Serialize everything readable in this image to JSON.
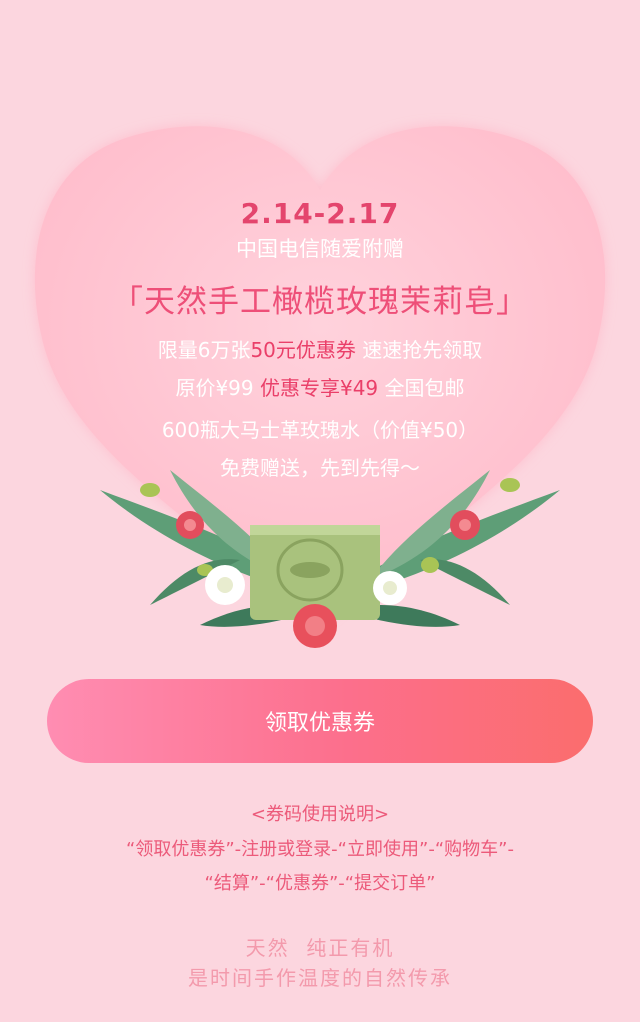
{
  "promo": {
    "date_range": "2.14-2.17",
    "subtitle": "中国电信随爱附赠",
    "product_title": "「天然手工橄榄玫瑰茉莉皂」",
    "line1_a": "限量6万张",
    "line1_b": "50元优惠券",
    "line1_c": " 速速抢先领取",
    "line2_a": "原价¥99 ",
    "line2_b": "优惠专享¥49",
    "line2_c": " 全国包邮",
    "line3": "600瓶大马士革玫瑰水（价值¥50）",
    "line4": "免费赠送，先到先得～"
  },
  "action": {
    "claim_label": "领取优惠券"
  },
  "instructions": {
    "title": "<券码使用说明>",
    "step_line1": "“领取优惠券”-注册或登录-“立即使用”-“购物车”-",
    "step_line2": "“结算”-“优惠券”-“提交订单”"
  },
  "tagline": {
    "line1": "天然  纯正有机",
    "line2": "是时间手作温度的自然传承"
  },
  "colors": {
    "background": "#fcd6df",
    "heart": "#ffc4d1",
    "accent": "#e4456d",
    "button_start": "#ff8db2",
    "button_end": "#fb6d6d"
  }
}
